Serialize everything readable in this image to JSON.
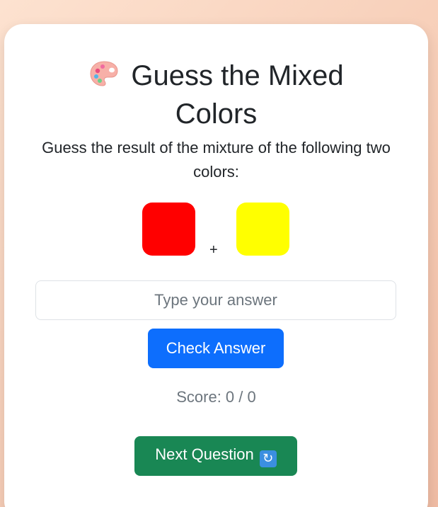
{
  "title": {
    "icon": "palette-icon",
    "text": "Guess the Mixed Colors"
  },
  "subtitle": "Guess the result of the mixture of the following two colors:",
  "swatches": {
    "color_1": "#ff0000",
    "color_2": "#ffff00",
    "operator": "+"
  },
  "answer": {
    "placeholder": "Type your answer",
    "value": ""
  },
  "check_button": {
    "label": "Check Answer",
    "color": "#0d6efd"
  },
  "score": {
    "text": "Score: 0 / 0"
  },
  "next_button": {
    "label": "Next Question",
    "icon": "refresh-icon",
    "color": "#198754"
  }
}
